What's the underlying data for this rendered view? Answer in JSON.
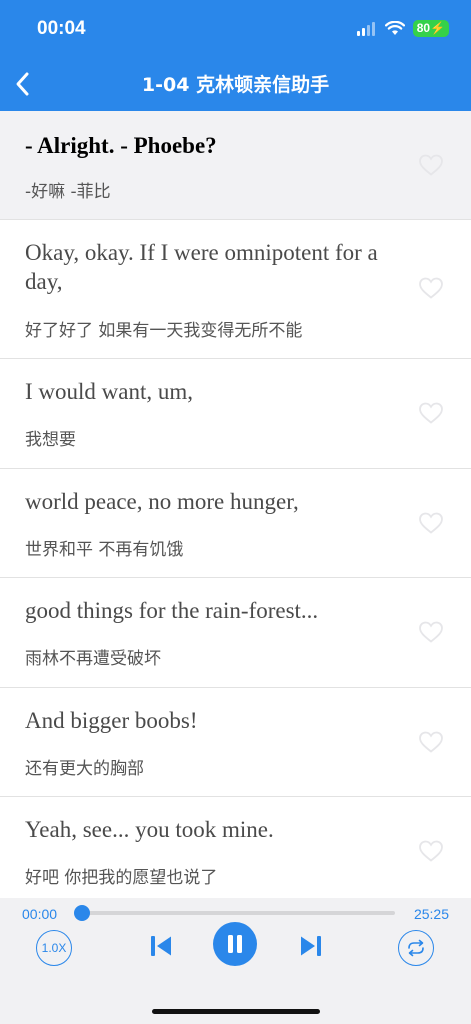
{
  "status": {
    "time": "00:04",
    "battery": "80"
  },
  "nav": {
    "title": "1-04 克林顿亲信助手"
  },
  "lines": [
    {
      "en": "- Alright. - Phoebe?",
      "zh": "-好嘛  -菲比",
      "active": true
    },
    {
      "en": "Okay, okay. If I were omnipotent for a day,",
      "zh": "好了好了  如果有一天我变得无所不能"
    },
    {
      "en": "I would want, um,",
      "zh": "我想要"
    },
    {
      "en": "world peace, no more hunger,",
      "zh": "世界和平  不再有饥饿"
    },
    {
      "en": "good things for the rain-forest...",
      "zh": "雨林不再遭受破坏"
    },
    {
      "en": "And bigger boobs!",
      "zh": "还有更大的胸部"
    },
    {
      "en": "Yeah, see... you took mine.",
      "zh": "好吧  你把我的愿望也说了"
    }
  ],
  "player": {
    "current": "00:00",
    "total": "25:25",
    "speed": "1.0X",
    "progress": 0
  },
  "colors": {
    "accent": "#2a87ea",
    "battery": "#35d14a"
  },
  "icons": {
    "back": "chevron-left-icon",
    "favorite": "heart-outline-icon",
    "prev": "skip-previous-icon",
    "pause": "pause-icon",
    "next": "skip-next-icon",
    "loop": "repeat-icon"
  }
}
